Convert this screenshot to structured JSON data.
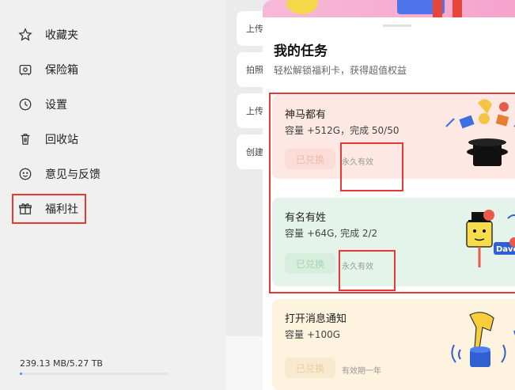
{
  "sidebar": {
    "items": [
      {
        "label": "收藏夹",
        "icon": "star-icon"
      },
      {
        "label": "保险箱",
        "icon": "safe-icon"
      },
      {
        "label": "设置",
        "icon": "settings-icon"
      },
      {
        "label": "回收站",
        "icon": "trash-icon"
      },
      {
        "label": "意见与反馈",
        "icon": "smile-icon"
      },
      {
        "label": "福利社",
        "icon": "gift-icon"
      }
    ],
    "storage": "239.13 MB/5.27 TB",
    "storage_used_fraction": 4e-05
  },
  "middle_list": [
    "上传",
    "拍照",
    "上传",
    "创建"
  ],
  "panel": {
    "title": "我的任务",
    "subtitle": "轻松解锁福利卡，获得超值权益",
    "tasks": [
      {
        "name": "神马都有",
        "detail": "容量 +512G，完成 50/50",
        "button": "已兑换",
        "validity": "永久有效",
        "bg": "#fde8e3"
      },
      {
        "name": "有名有姓",
        "detail": "容量 +64G, 完成 2/2",
        "button": "已兑换",
        "validity": "永久有效",
        "bg": "#e5f4ea"
      },
      {
        "name": "打开消息通知",
        "detail": "容量 +100G",
        "button": "已兑换",
        "validity": "有效期一年",
        "bg": "#fdf3df"
      }
    ],
    "art_badge_text": "Dave"
  },
  "colors": {
    "highlight": "#e53935",
    "storage_accent": "#4a8cff"
  }
}
